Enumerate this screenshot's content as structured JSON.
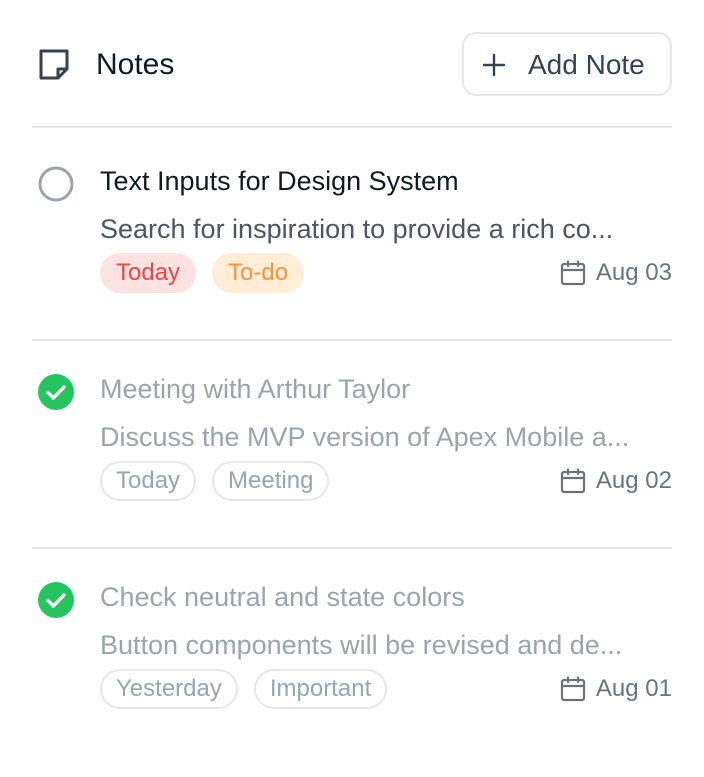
{
  "header": {
    "title": "Notes",
    "title_icon": "note-icon",
    "add_button": {
      "label": "Add Note",
      "icon": "plus-icon"
    }
  },
  "colors": {
    "done_check": "#22c55e",
    "tag_today_bg": "#fee2e2",
    "tag_today_text": "#ef4444",
    "tag_todo_bg": "#ffedd5",
    "tag_todo_text": "#fb923c"
  },
  "notes": [
    {
      "title": "Text Inputs for Design System",
      "description": "Search for inspiration to provide a rich co...",
      "completed": false,
      "tags": [
        "Today",
        "To-do"
      ],
      "date": "Aug 03"
    },
    {
      "title": "Meeting with Arthur Taylor",
      "description": "Discuss the MVP version of Apex Mobile a...",
      "completed": true,
      "tags": [
        "Today",
        "Meeting"
      ],
      "date": "Aug 02"
    },
    {
      "title": "Check neutral and state colors",
      "description": "Button components will be revised and de...",
      "completed": true,
      "tags": [
        "Yesterday",
        "Important"
      ],
      "date": "Aug 01"
    }
  ]
}
